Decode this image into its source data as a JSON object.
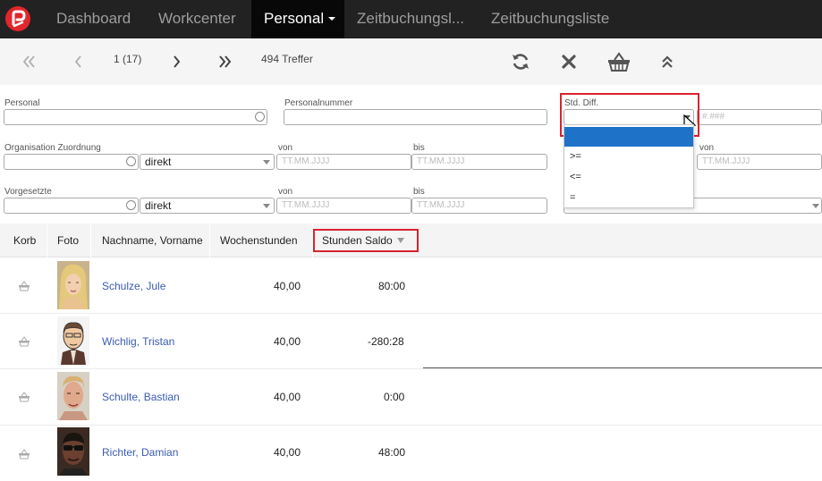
{
  "nav": {
    "items": [
      {
        "label": "Dashboard"
      },
      {
        "label": "Workcenter"
      },
      {
        "label": "Personal"
      },
      {
        "label": "Zeitbuchungsl..."
      },
      {
        "label": "Zeitbuchungsliste"
      }
    ]
  },
  "toolbar": {
    "page_info": "1 (17)",
    "hits": "494 Treffer"
  },
  "filters": {
    "personal_label": "Personal",
    "personalnummer_label": "Personalnummer",
    "std_diff_label": "Std. Diff.",
    "std_diff_placeholder": "#.###",
    "org_label": "Organisation Zuordnung",
    "org_mode": "direkt",
    "org_von_label": "von",
    "org_bis_label": "bis",
    "org_von_placeholder": "TT.MM.JJJJ",
    "org_bis_placeholder": "TT.MM.JJJJ",
    "right_von_label": "von",
    "right_von_placeholder": "TT.MM.JJJJ",
    "vorgesetzte_label": "Vorgesetzte",
    "vorg_mode": "direkt",
    "vorg_von_label": "von",
    "vorg_bis_label": "bis",
    "vorg_von_placeholder": "TT.MM.JJJJ",
    "vorg_bis_placeholder": "TT.MM.JJJJ"
  },
  "std_diff_options": [
    "",
    ">=",
    "<=",
    "="
  ],
  "table": {
    "columns": [
      "Korb",
      "Foto",
      "Nachname, Vorname",
      "Wochenstunden",
      "Stunden Saldo"
    ],
    "rows": [
      {
        "name": "Schulze, Jule",
        "hours": "40,00",
        "saldo": "80:00"
      },
      {
        "name": "Wichlig, Tristan",
        "hours": "40,00",
        "saldo": "-280:28"
      },
      {
        "name": "Schulte, Bastian",
        "hours": "40,00",
        "saldo": "0:00"
      },
      {
        "name": "Richter, Damian",
        "hours": "40,00",
        "saldo": "48:00"
      }
    ]
  },
  "colors": {
    "nav_bg": "#222222",
    "accent_red": "#d9232e",
    "link_blue": "#3a5bb0",
    "selected_blue": "#1e73c9"
  }
}
